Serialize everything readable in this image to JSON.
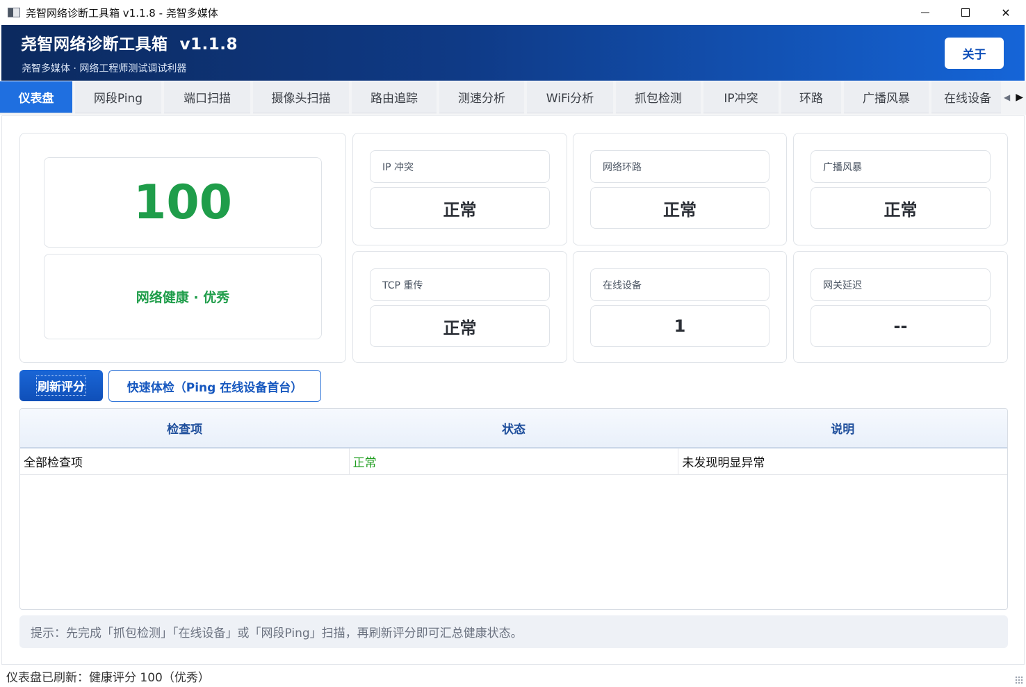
{
  "window": {
    "title": "尧智网络诊断工具箱 v1.1.8 - 尧智多媒体",
    "minimize": "",
    "maximize": "",
    "close": "✕"
  },
  "header": {
    "title": "尧智网络诊断工具箱  v1.1.8",
    "subtitle": "尧智多媒体 · 网络工程师测试调试利器",
    "about_label": "关于"
  },
  "tabs": [
    {
      "label": "仪表盘",
      "active": true
    },
    {
      "label": "网段Ping"
    },
    {
      "label": "端口扫描"
    },
    {
      "label": "摄像头扫描"
    },
    {
      "label": "路由追踪"
    },
    {
      "label": "测速分析"
    },
    {
      "label": "WiFi分析"
    },
    {
      "label": "抓包检测"
    },
    {
      "label": "IP冲突"
    },
    {
      "label": "环路"
    },
    {
      "label": "广播风暴"
    },
    {
      "label": "在线设备"
    }
  ],
  "dashboard": {
    "score": "100",
    "health": "网络健康 · 优秀",
    "metrics": [
      {
        "label": "IP 冲突",
        "value": "正常"
      },
      {
        "label": "网络环路",
        "value": "正常"
      },
      {
        "label": "广播风暴",
        "value": "正常"
      },
      {
        "label": "TCP 重传",
        "value": "正常"
      },
      {
        "label": "在线设备",
        "value": "1"
      },
      {
        "label": "网关延迟",
        "value": "--"
      }
    ]
  },
  "actions": {
    "refresh_label": "刷新评分",
    "quick_check_label": "快速体检（Ping 在线设备首台）"
  },
  "table": {
    "headers": [
      "检查项",
      "状态",
      "说明"
    ],
    "rows": [
      [
        "全部检查项",
        "正常",
        "未发现明显异常"
      ]
    ]
  },
  "hint": "提示：先完成「抓包检测」「在线设备」或「网段Ping」扫描，再刷新评分即可汇总健康状态。",
  "status": "仪表盘已刷新：健康评分 100（优秀）"
}
